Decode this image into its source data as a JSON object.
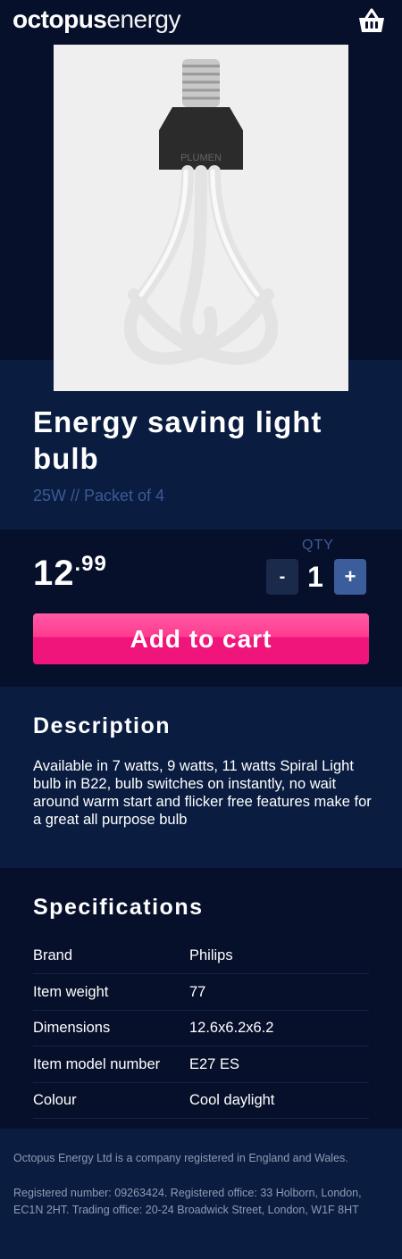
{
  "header": {
    "logo_bold": "octopus",
    "logo_light": "energy",
    "cart_icon": "basket-icon"
  },
  "product": {
    "image_alt": "Plumen light bulb",
    "image_brand_text": "PLUMEN",
    "title": "Energy saving light bulb",
    "subtitle": "25W // Packet of 4",
    "price_whole": "12",
    "price_fraction": ".99",
    "qty_label": "QTY",
    "qty_value": "1",
    "minus_label": "-",
    "plus_label": "+",
    "add_to_cart_label": "Add to cart"
  },
  "description": {
    "heading": "Description",
    "text": "Available in 7 watts, 9 watts, 11 watts Spiral Light bulb in B22, bulb switches on instantly, no wait around warm start and flicker free features make for a great all purpose bulb"
  },
  "specifications": {
    "heading": "Specifications",
    "rows": [
      {
        "key": "Brand",
        "value": "Philips"
      },
      {
        "key": "Item weight",
        "value": "77"
      },
      {
        "key": "Dimensions",
        "value": "12.6x6.2x6.2"
      },
      {
        "key": "Item model number",
        "value": "E27 ES"
      },
      {
        "key": "Colour",
        "value": "Cool daylight"
      }
    ]
  },
  "footer": {
    "line1": "Octopus Energy Ltd is a company registered in England and Wales.",
    "line2": "Registered number: 09263424. Registered office: 33 Holborn, London, EC1N 2HT. Trading office: 20-24 Broadwick Street, London, W1F 8HT"
  },
  "colors": {
    "navy": "#07102b",
    "band": "#0a1d40",
    "accent_pink": "#f0157a",
    "muted_blue": "#3c5a96"
  }
}
